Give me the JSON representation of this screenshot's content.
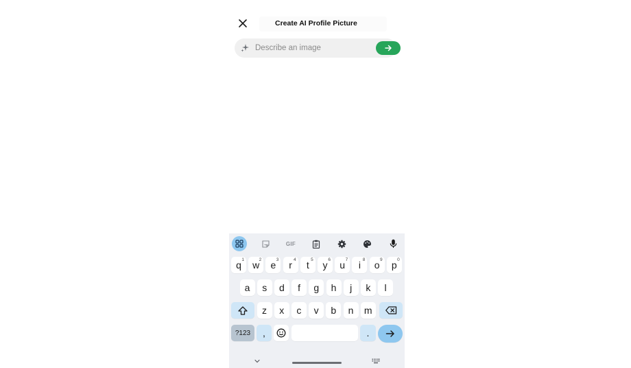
{
  "header": {
    "title": "Create AI Profile Picture",
    "close_icon": "close-icon"
  },
  "prompt": {
    "placeholder": "Describe an image",
    "value": "",
    "sparkle_icon": "sparkle-icon",
    "send_icon": "arrow-right-icon",
    "send_color": "#27a55a"
  },
  "keyboard": {
    "toolbar": [
      "apps-grid-icon",
      "sticker-icon",
      "GIF",
      "clipboard-icon",
      "settings-gear-icon",
      "palette-icon",
      "microphone-icon"
    ],
    "row1": [
      {
        "k": "q",
        "h": "1"
      },
      {
        "k": "w",
        "h": "2"
      },
      {
        "k": "e",
        "h": "3"
      },
      {
        "k": "r",
        "h": "4"
      },
      {
        "k": "t",
        "h": "5"
      },
      {
        "k": "y",
        "h": "6"
      },
      {
        "k": "u",
        "h": "7"
      },
      {
        "k": "i",
        "h": "8"
      },
      {
        "k": "o",
        "h": "9"
      },
      {
        "k": "p",
        "h": "0"
      }
    ],
    "row2": [
      "a",
      "s",
      "d",
      "f",
      "g",
      "h",
      "j",
      "k",
      "l"
    ],
    "row3": [
      "z",
      "x",
      "c",
      "v",
      "b",
      "n",
      "m"
    ],
    "symbols_label": "?123",
    "comma": ",",
    "period": ".",
    "accent_color": "#8ec7ef"
  }
}
